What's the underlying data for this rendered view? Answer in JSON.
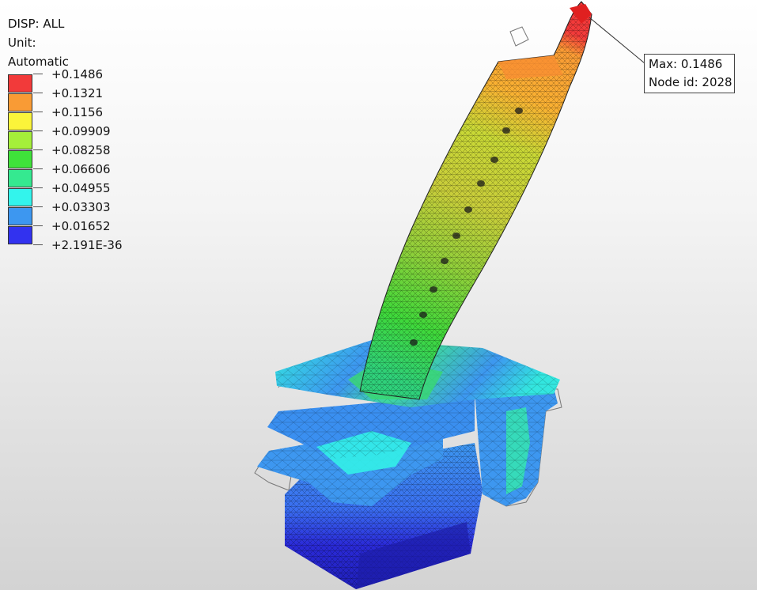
{
  "legend": {
    "result_label": "DISP: ALL",
    "unit_label": "Unit:",
    "mode_label": "Automatic",
    "scale": [
      {
        "label": "+0.1486",
        "color": "#f23a3a"
      },
      {
        "label": "+0.1321",
        "color": "#f99b35"
      },
      {
        "label": "+0.1156",
        "color": "#fbf43a"
      },
      {
        "label": "+0.09909",
        "color": "#a5ef3a"
      },
      {
        "label": "+0.08258",
        "color": "#3fe23a"
      },
      {
        "label": "+0.06606",
        "color": "#35e990"
      },
      {
        "label": "+0.04955",
        "color": "#33f4ec"
      },
      {
        "label": "+0.03303",
        "color": "#3d97f0"
      },
      {
        "label": "+0.01652",
        "color": "#3232ef"
      },
      {
        "label": "+2.191E-36",
        "color": null
      }
    ]
  },
  "callout": {
    "max_text": "Max: 0.1486",
    "node_text": "Node id: 2028"
  }
}
